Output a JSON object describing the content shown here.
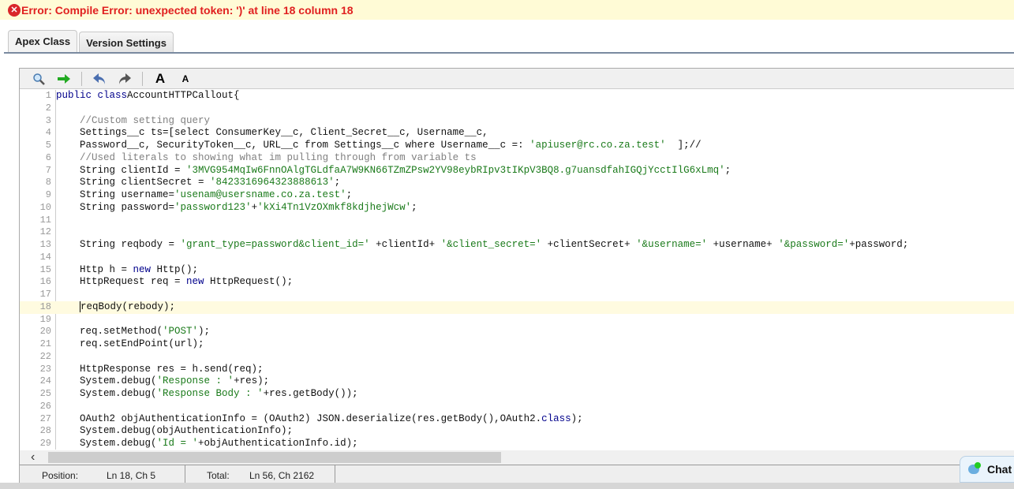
{
  "error": {
    "icon": "error-circle-icon",
    "text": "Error: Compile Error: unexpected token: ')' at line 18 column 18"
  },
  "tabs": [
    {
      "label": "Apex Class",
      "active": true
    },
    {
      "label": "Version Settings",
      "active": false
    }
  ],
  "toolbar": {
    "icons": [
      "search-icon",
      "go-to-line-icon",
      "undo-icon",
      "redo-icon",
      "font-larger-icon",
      "font-smaller-icon"
    ],
    "font_larger": "A",
    "font_smaller": "A"
  },
  "editor": {
    "highlighted_line": 18,
    "lines": [
      [
        [
          "k",
          "public class"
        ],
        [
          "",
          "AccountHTTPCallout{"
        ]
      ],
      [],
      [
        [
          "",
          "    "
        ],
        [
          "c",
          "//Custom setting query"
        ]
      ],
      [
        [
          "",
          "    Settings__c ts=[select ConsumerKey__c, Client_Secret__c, Username__c,"
        ]
      ],
      [
        [
          "",
          "    Password__c, SecurityToken__c, URL__c from Settings__c where Username__c =: "
        ],
        [
          "s",
          "'apiuser@rc.co.za.test'"
        ],
        [
          "",
          "  ];//"
        ]
      ],
      [
        [
          "",
          "    "
        ],
        [
          "c",
          "//Used literals to showing what im pulling through from variable ts"
        ]
      ],
      [
        [
          "",
          "    String clientId = "
        ],
        [
          "s",
          "'3MVG954MqIw6FnnOAlgTGLdfaA7W9KN66TZmZPsw2YV98eybRIpv3tIKpV3BQ8.g7uansdfahIGQjYcctIlG6xLmq'"
        ],
        [
          "",
          ";"
        ]
      ],
      [
        [
          "",
          "    String clientSecret = "
        ],
        [
          "s",
          "'8423316964323888613'"
        ],
        [
          "",
          ";"
        ]
      ],
      [
        [
          "",
          "    String username="
        ],
        [
          "s",
          "'usenam@usersname.co.za.test'"
        ],
        [
          "",
          ";"
        ]
      ],
      [
        [
          "",
          "    String password="
        ],
        [
          "s",
          "'password123'"
        ],
        [
          "",
          "+"
        ],
        [
          "s",
          "'kXi4Tn1VzOXmkf8kdjhejWcw'"
        ],
        [
          "",
          ";"
        ]
      ],
      [],
      [],
      [
        [
          "",
          "    String reqbody = "
        ],
        [
          "s",
          "'grant_type=password&client_id='"
        ],
        [
          "",
          " +clientId+ "
        ],
        [
          "s",
          "'&client_secret='"
        ],
        [
          "",
          " +clientSecret+ "
        ],
        [
          "s",
          "'&username='"
        ],
        [
          "",
          " +username+ "
        ],
        [
          "s",
          "'&password='"
        ],
        [
          "",
          "+password;"
        ]
      ],
      [],
      [
        [
          "",
          "    Http h = "
        ],
        [
          "k",
          "new"
        ],
        [
          "",
          " Http();"
        ]
      ],
      [
        [
          "",
          "    HttpRequest req = "
        ],
        [
          "k",
          "new"
        ],
        [
          "",
          " HttpRequest();"
        ]
      ],
      [],
      [
        [
          "",
          "    "
        ],
        [
          "cur",
          ""
        ],
        [
          "",
          "reqBody(rebody);"
        ]
      ],
      [],
      [
        [
          "",
          "    req.setMethod("
        ],
        [
          "s",
          "'POST'"
        ],
        [
          "",
          ");"
        ]
      ],
      [
        [
          "",
          "    req.setEndPoint(url);"
        ]
      ],
      [],
      [
        [
          "",
          "    HttpResponse res = h.send(req);"
        ]
      ],
      [
        [
          "",
          "    System.debug("
        ],
        [
          "s",
          "'Response : '"
        ],
        [
          "",
          "+res);"
        ]
      ],
      [
        [
          "",
          "    System.debug("
        ],
        [
          "s",
          "'Response Body : '"
        ],
        [
          "",
          "+res.getBody());"
        ]
      ],
      [],
      [
        [
          "",
          "    OAuth2 objAuthenticationInfo = (OAuth2) JSON.deserialize(res.getBody(),OAuth2."
        ],
        [
          "k",
          "class"
        ],
        [
          "",
          ");"
        ]
      ],
      [
        [
          "",
          "    System.debug(objAuthenticationInfo);"
        ]
      ],
      [
        [
          "",
          "    System.debug("
        ],
        [
          "s",
          "'Id = '"
        ],
        [
          "",
          "+objAuthenticationInfo.id);"
        ]
      ]
    ]
  },
  "status": {
    "position_label": "Position:",
    "position_value": "Ln 18, Ch 5",
    "total_label": "Total:",
    "total_value": "Ln 56, Ch 2162"
  },
  "chat": {
    "label": "Chat"
  }
}
